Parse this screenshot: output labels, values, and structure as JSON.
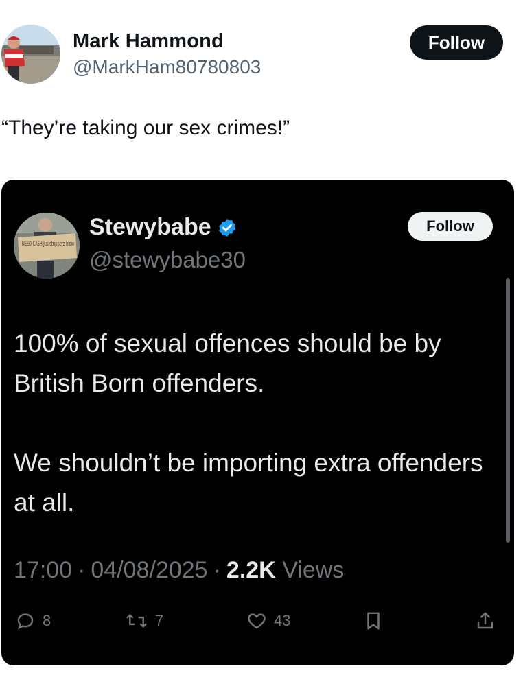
{
  "outer_tweet": {
    "name": "Mark Hammond",
    "handle": "@MarkHam80780803",
    "follow_label": "Follow",
    "text": "“They’re taking our sex crimes!”"
  },
  "quoted_tweet": {
    "name": "Stewybabe",
    "handle": "@stewybabe30",
    "follow_label": "Follow",
    "verified_icon": "verified-badge-icon",
    "paragraphs": [
      "100% of sexual offences should be by British Born offenders.",
      "We shouldn’t be importing extra offenders at all."
    ],
    "time": "17:00",
    "date": "04/08/2025",
    "views_count": "2.2K",
    "views_label": "Views",
    "separator": "·",
    "replies": "8",
    "retweets": "7",
    "likes": "43",
    "avatar_sign_text": "NEED CASH Jus stripperz blow"
  },
  "colors": {
    "follow_dark": "#0f1419",
    "card_bg": "#000000",
    "verified": "#1d9bf0",
    "muted": "#71767b"
  }
}
